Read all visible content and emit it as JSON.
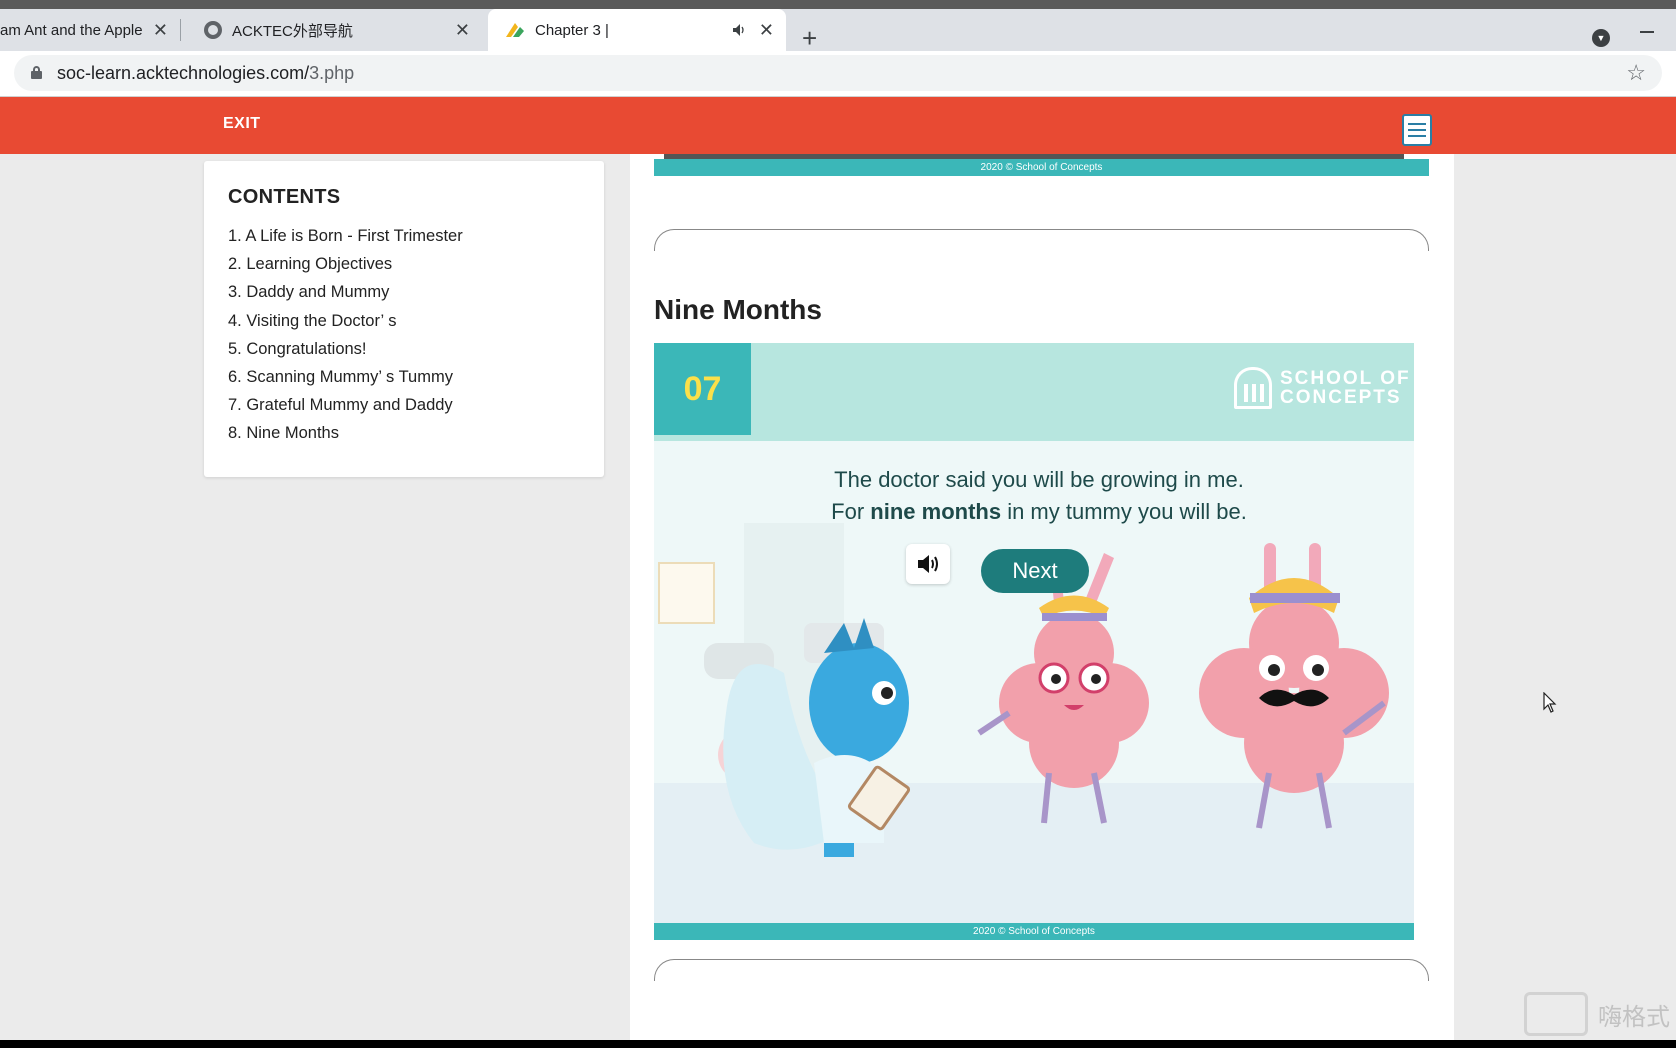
{
  "browser": {
    "tabs": [
      {
        "title": "am Ant and the Apple",
        "active": false
      },
      {
        "title": "ACKTEC外部导航",
        "active": false
      },
      {
        "title": "Chapter 3 |",
        "active": true
      }
    ],
    "url_host": "soc-learn.acktechnologies.com/",
    "url_path": "3.php"
  },
  "header": {
    "exit_label": "EXIT",
    "notes_icon": "notes-icon"
  },
  "contents": {
    "title": "CONTENTS",
    "items": [
      "1. A Life is Born - First Trimester",
      "2. Learning Objectives",
      "3. Daddy and Mummy",
      "4. Visiting the Doctor’ s",
      "5. Congratulations!",
      "6. Scanning Mummy’ s Tummy",
      "7. Grateful Mummy and Daddy",
      "8. Nine Months"
    ]
  },
  "main": {
    "prev_copyright": "2020 © School of Concepts",
    "section_title": "Nine Months",
    "slide": {
      "number": "07",
      "logo_line1": "SCHOOL OF",
      "logo_line2": "CONCEPTS",
      "text_line1": "The doctor said you will be growing in me.",
      "text_line2_pre": "For ",
      "text_line2_bold": "nine months",
      "text_line2_post": " in my tummy you will be.",
      "next_label": "Next",
      "copyright": "2020 © School of Concepts"
    }
  },
  "watermark": {
    "text": "嗨格式"
  },
  "colors": {
    "header_bar": "#e84a33",
    "teal": "#3bb7b8",
    "next_button": "#1e7c7c"
  }
}
